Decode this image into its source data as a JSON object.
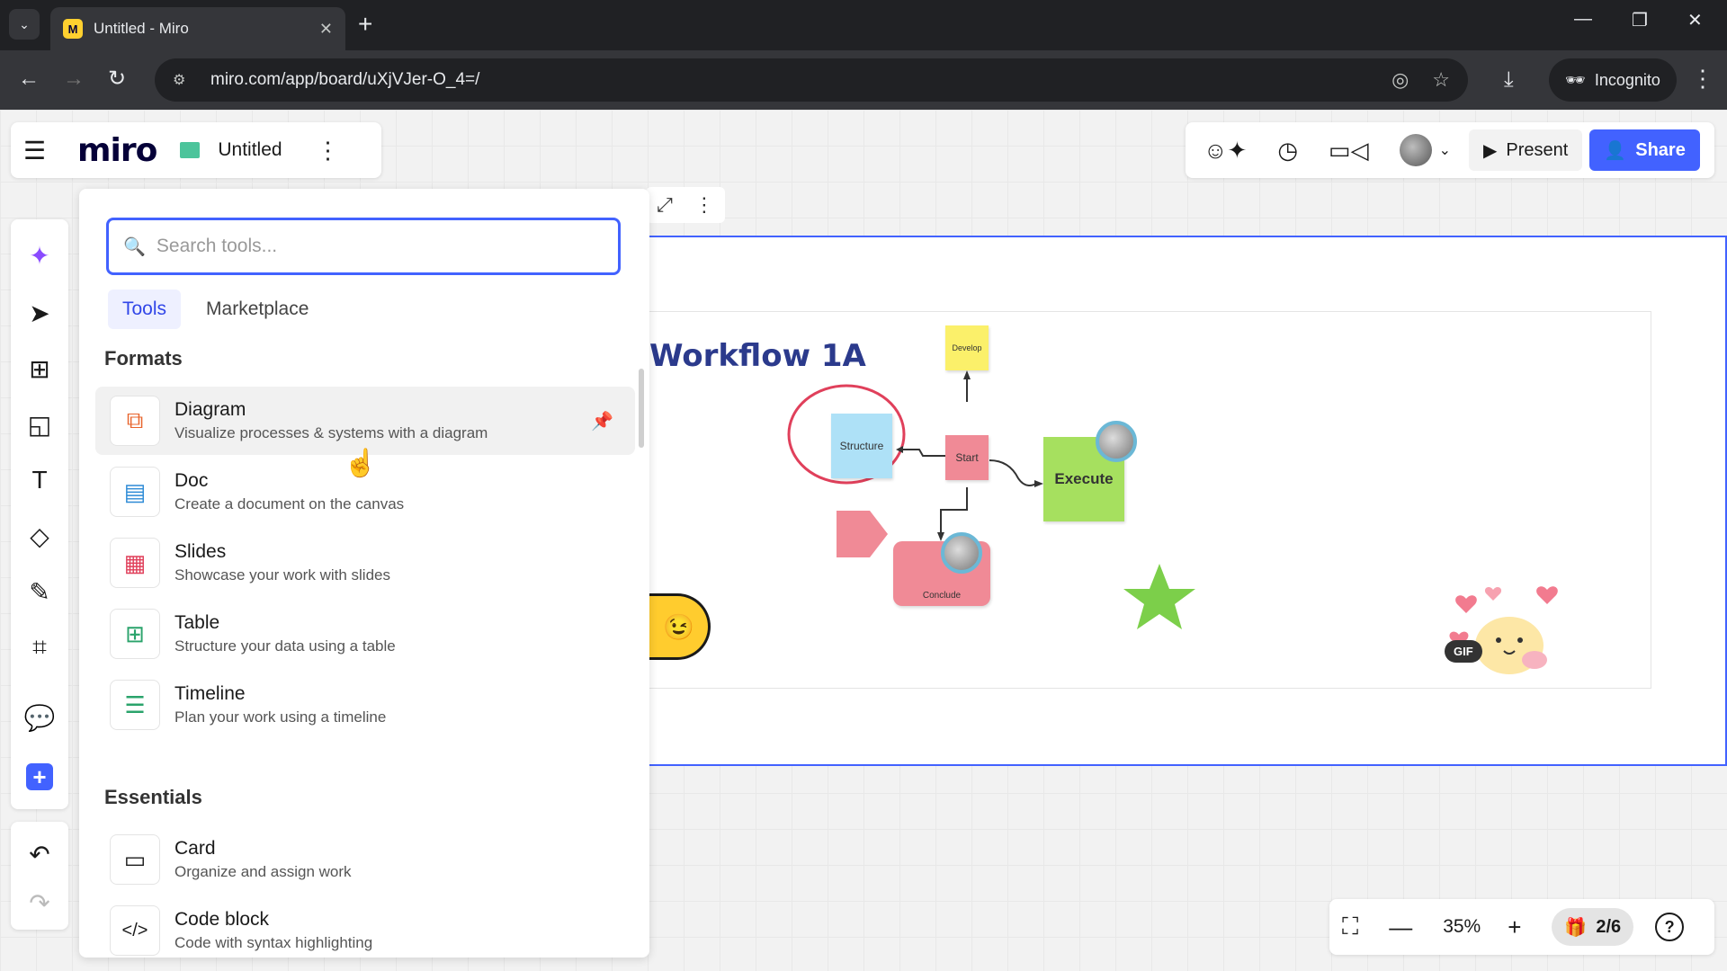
{
  "browser": {
    "tab_title": "Untitled - Miro",
    "url": "miro.com/app/board/uXjVJer-O_4=/",
    "incognito_label": "Incognito"
  },
  "header": {
    "board_title": "Untitled",
    "logo_text": "miro",
    "present_label": "Present",
    "share_label": "Share"
  },
  "tools_panel": {
    "search_placeholder": "Search tools...",
    "tabs": [
      "Tools",
      "Marketplace"
    ],
    "formats_heading": "Formats",
    "essentials_heading": "Essentials",
    "formats": [
      {
        "title": "Diagram",
        "desc": "Visualize processes & systems with a diagram",
        "icon": "diagram-icon",
        "color": "#e8642c"
      },
      {
        "title": "Doc",
        "desc": "Create a document on the canvas",
        "icon": "doc-icon",
        "color": "#2e8bd6"
      },
      {
        "title": "Slides",
        "desc": "Showcase your work with slides",
        "icon": "slides-icon",
        "color": "#e0405b"
      },
      {
        "title": "Table",
        "desc": "Structure your data using a table",
        "icon": "table-icon",
        "color": "#2aa36b"
      },
      {
        "title": "Timeline",
        "desc": "Plan your work using a timeline",
        "icon": "timeline-icon",
        "color": "#2aa36b"
      }
    ],
    "essentials": [
      {
        "title": "Card",
        "desc": "Organize and assign work",
        "icon": "card-icon"
      },
      {
        "title": "Code block",
        "desc": "Code with syntax highlighting",
        "icon": "code-block-icon"
      }
    ]
  },
  "board": {
    "frame_title": "Workflow 1A",
    "notes": {
      "develop": "Develop",
      "structure": "Structure",
      "start": "Start",
      "execute": "Execute",
      "conclude": "Conclude"
    },
    "gif_label": "GIF"
  },
  "zoom": {
    "level": "35%",
    "pages": "2/6"
  }
}
